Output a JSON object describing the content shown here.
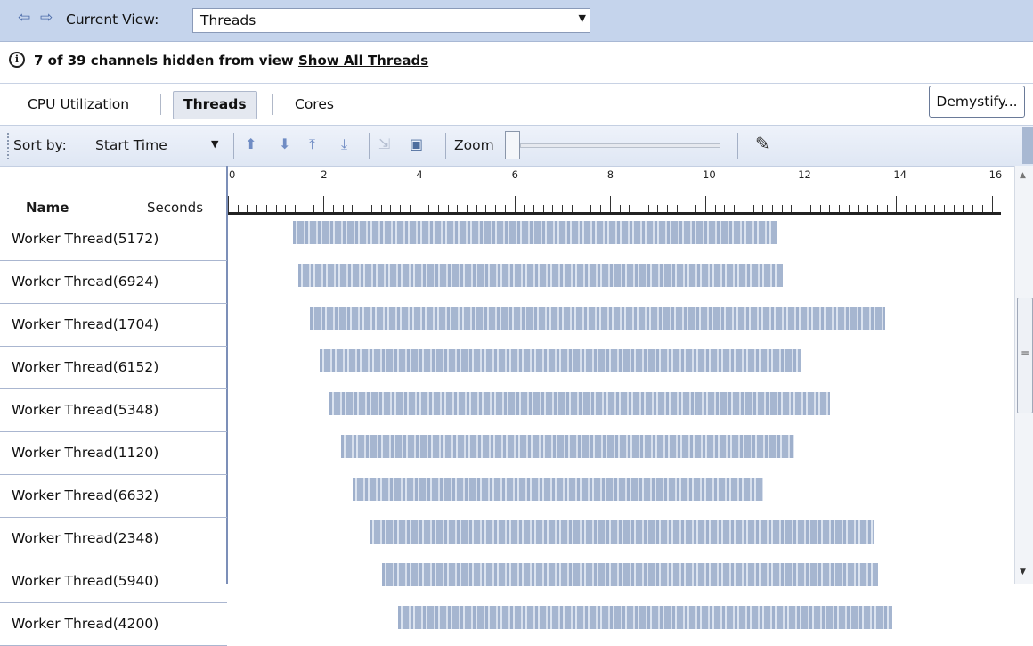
{
  "nav": {
    "back_icon": "arrow-left-icon",
    "forward_icon": "arrow-right-icon"
  },
  "current_view": {
    "label": "Current View:",
    "value": "Threads"
  },
  "info": {
    "icon": "info-icon",
    "text": "7 of 39 channels hidden from view",
    "link": "Show All Threads"
  },
  "tabs": [
    {
      "label": "CPU Utilization",
      "selected": false
    },
    {
      "label": "Threads",
      "selected": true
    },
    {
      "label": "Cores",
      "selected": false
    }
  ],
  "demystify_label": "Demystify...",
  "toolbar": {
    "sort_label": "Sort by:",
    "sort_value": "Start Time",
    "zoom_label": "Zoom",
    "zoom_level": 0,
    "icons": [
      "move-up-icon",
      "move-down-icon",
      "move-top-icon",
      "move-bottom-icon",
      "export-icon",
      "save-icon",
      "pen-icon"
    ]
  },
  "table": {
    "col_name": "Name",
    "col_seconds": "Seconds",
    "ticks": [
      "0",
      "2",
      "4",
      "6",
      "8",
      "10",
      "12",
      "14",
      "16"
    ],
    "rows": [
      {
        "name": "Worker Thread(5172)",
        "start": 1.35,
        "end": 11.5
      },
      {
        "name": "Worker Thread(6924)",
        "start": 1.45,
        "end": 11.6
      },
      {
        "name": "Worker Thread(1704)",
        "start": 1.7,
        "end": 13.75
      },
      {
        "name": "Worker Thread(6152)",
        "start": 1.9,
        "end": 12.0
      },
      {
        "name": "Worker Thread(5348)",
        "start": 2.1,
        "end": 12.6
      },
      {
        "name": "Worker Thread(1120)",
        "start": 2.35,
        "end": 11.85
      },
      {
        "name": "Worker Thread(6632)",
        "start": 2.6,
        "end": 11.2
      },
      {
        "name": "Worker Thread(2348)",
        "start": 2.95,
        "end": 13.5
      },
      {
        "name": "Worker Thread(5940)",
        "start": 3.2,
        "end": 13.6
      },
      {
        "name": "Worker Thread(4200)",
        "start": 3.55,
        "end": 13.9
      }
    ]
  }
}
